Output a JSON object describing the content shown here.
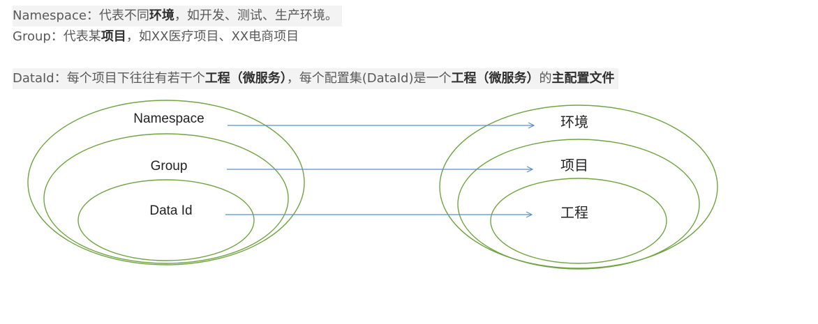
{
  "text_lines": [
    {
      "segments": [
        {
          "text": "Namespace：代表不同",
          "bold": false
        },
        {
          "text": "环境",
          "bold": true
        },
        {
          "text": "，如开发、测试、生产环境。",
          "bold": false
        }
      ]
    },
    {
      "segments": [
        {
          "text": "Group：代表某",
          "bold": false
        },
        {
          "text": "项目",
          "bold": true
        },
        {
          "text": "，如XX医疗项目、XX电商项目",
          "bold": false
        }
      ]
    },
    {
      "segments": [
        {
          "text": "DataId：每个项目下往往有若干个",
          "bold": false
        },
        {
          "text": "工程（微服务）",
          "bold": true
        },
        {
          "text": "，每个配置集(DataId)是一个",
          "bold": false
        },
        {
          "text": "工程（微服务）",
          "bold": true
        },
        {
          "text": "的",
          "bold": false
        },
        {
          "text": "主配置文件",
          "bold": true
        }
      ]
    }
  ],
  "diagram": {
    "left_labels": {
      "namespace": "Namespace",
      "group": "Group",
      "data_id": "Data Id"
    },
    "right_labels": {
      "environment": "环境",
      "project": "项目",
      "engineering": "工程"
    },
    "colors": {
      "ellipse": "#70a442",
      "arrow": "#5b8fc9"
    }
  }
}
